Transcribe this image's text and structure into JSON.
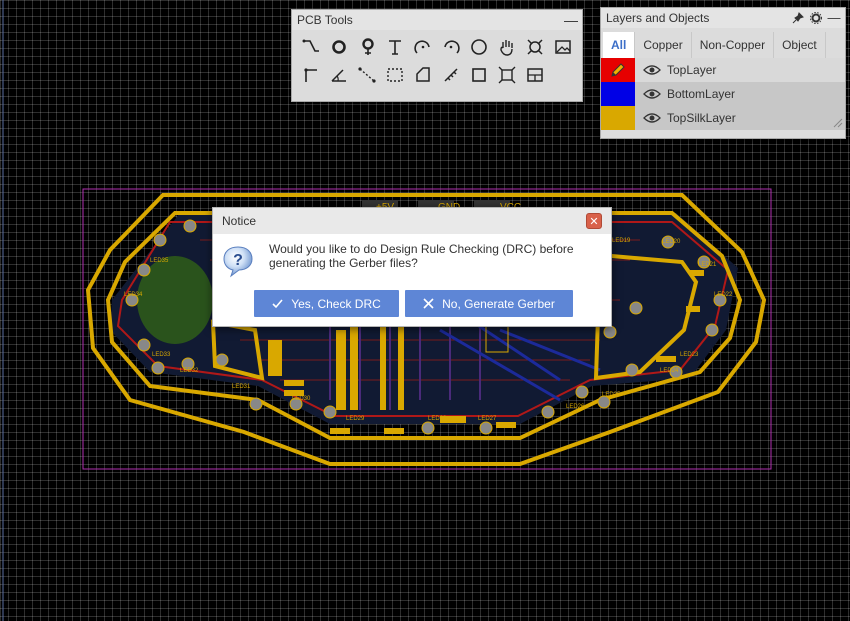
{
  "pcb_tools": {
    "title": "PCB Tools",
    "minimize_label": "—",
    "tools": [
      {
        "icon": "track-icon"
      },
      {
        "icon": "pad-icon"
      },
      {
        "icon": "via-icon"
      },
      {
        "icon": "text-icon"
      },
      {
        "icon": "arc-icon"
      },
      {
        "icon": "arc-center-icon"
      },
      {
        "icon": "circle-icon"
      },
      {
        "icon": "hand-pan-icon"
      },
      {
        "icon": "hole-icon"
      },
      {
        "icon": "image-icon"
      },
      {
        "icon": "connect-pad-icon"
      },
      {
        "icon": "angle-dimension-icon"
      },
      {
        "icon": "dimension-icon"
      },
      {
        "icon": "rect-select-icon"
      },
      {
        "icon": "solid-region-icon"
      },
      {
        "icon": "measure-icon"
      },
      {
        "icon": "rectangle-icon"
      },
      {
        "icon": "copper-area-icon"
      },
      {
        "icon": "layout-icon"
      }
    ]
  },
  "layers_panel": {
    "title": "Layers and Objects",
    "tabs": [
      {
        "label": "All",
        "active": true
      },
      {
        "label": "Copper",
        "active": false
      },
      {
        "label": "Non-Copper",
        "active": false
      },
      {
        "label": "Object",
        "active": false
      }
    ],
    "layers": [
      {
        "name": "TopLayer",
        "color": "#e60000",
        "icon": "pencil-icon"
      },
      {
        "name": "BottomLayer",
        "color": "#0000e6"
      },
      {
        "name": "TopSilkLayer",
        "color": "#d9a800"
      }
    ]
  },
  "notice": {
    "title": "Notice",
    "close_label": "✕",
    "message": "Would you like to do Design Rule Checking (DRC) before generating the Gerber files?",
    "yes_label": "Yes, Check DRC",
    "no_label": "No, Generate Gerber",
    "button_color": "#5e86d6"
  },
  "board": {
    "labels": [
      "+5V",
      "GND",
      "VCC",
      "LED19",
      "LED20",
      "LED21",
      "LED22",
      "LED23",
      "LED24",
      "LED25",
      "LED26",
      "LED27",
      "LED28",
      "LED29",
      "LED30",
      "LED31",
      "LED32",
      "LED33",
      "LED34",
      "LED35"
    ]
  }
}
